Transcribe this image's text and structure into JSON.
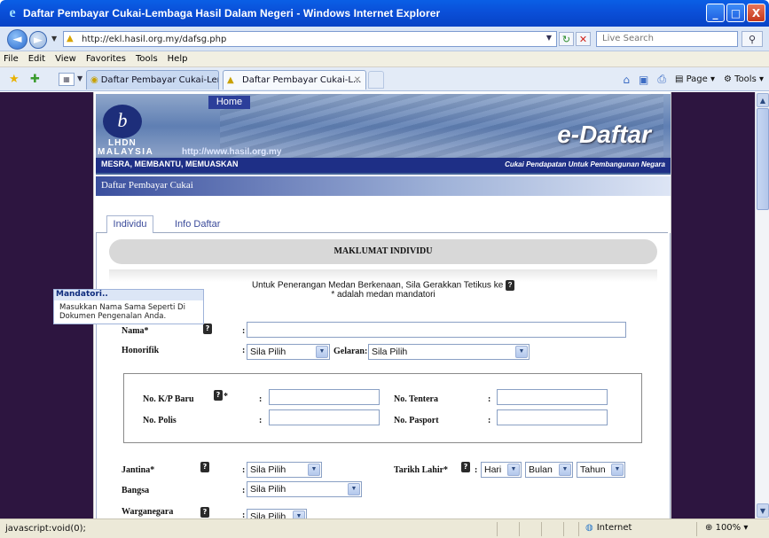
{
  "window": {
    "title": "Daftar Pembayar Cukai-Lembaga Hasil Dalam Negeri - Windows Internet Explorer",
    "min_glyph": "_",
    "max_glyph": "□",
    "close_glyph": "X"
  },
  "address": {
    "url": "http://ekl.hasil.org.my/dafsg.php",
    "search_placeholder": "Live Search"
  },
  "menu": [
    "File",
    "Edit",
    "View",
    "Favorites",
    "Tools",
    "Help"
  ],
  "tabs": [
    {
      "label": "Daftar Pembayar Cukai-Lemb..."
    },
    {
      "label": "Daftar Pembayar Cukai-L..."
    }
  ],
  "commands": {
    "page": "Page",
    "tools": "Tools"
  },
  "banner": {
    "home": "Home",
    "lhdn": "LHDN",
    "malaysia": "MALAYSIA",
    "url": "http://www.hasil.org.my",
    "edaftar": "e-Daftar",
    "slogan": "MESRA, MEMBANTU, MEMUASKAN",
    "tagline": "Cukai Pendapatan Untuk Pembangunan Negara"
  },
  "section_title": "Daftar Pembayar Cukai",
  "page_tabs": {
    "active": "Individu",
    "inactive": "Info Daftar"
  },
  "form": {
    "heading": "MAKLUMAT INDIVIDU",
    "info_line1": "Untuk Penerangan Medan Berkenaan, Sila Gerakkan Tetikus ke",
    "info_line2": "* adalah medan mandatori",
    "colon": ":",
    "nama_label": "Nama*",
    "honorifik_label": "Honorifik",
    "honorifik_value": "Sila Pilih",
    "gelaran_label": "Gelaran:",
    "gelaran_value": "Sila Pilih",
    "kp_baru_label": "No. K/P Baru",
    "kp_star": "*",
    "tentera_label": "No. Tentera",
    "polis_label": "No. Polis",
    "pasport_label": "No. Pasport",
    "jantina_label": "Jantina*",
    "jantina_value": "Sila Pilih",
    "tarikh_label": "Tarikh Lahir*",
    "hari_value": "Hari",
    "bulan_value": "Bulan",
    "tahun_value": "Tahun",
    "bangsa_label": "Bangsa",
    "bangsa_value": "Sila Pilih",
    "warganegara_label": "Warganegara",
    "warganegara_value": "Sila Pilih"
  },
  "tooltip": {
    "title": "Mandatori..",
    "body": "Masukkan Nama Sama Seperti Di Dokumen Pengenalan Anda."
  },
  "status": {
    "text": "javascript:void(0);",
    "zone": "Internet",
    "zoom": "100%"
  }
}
